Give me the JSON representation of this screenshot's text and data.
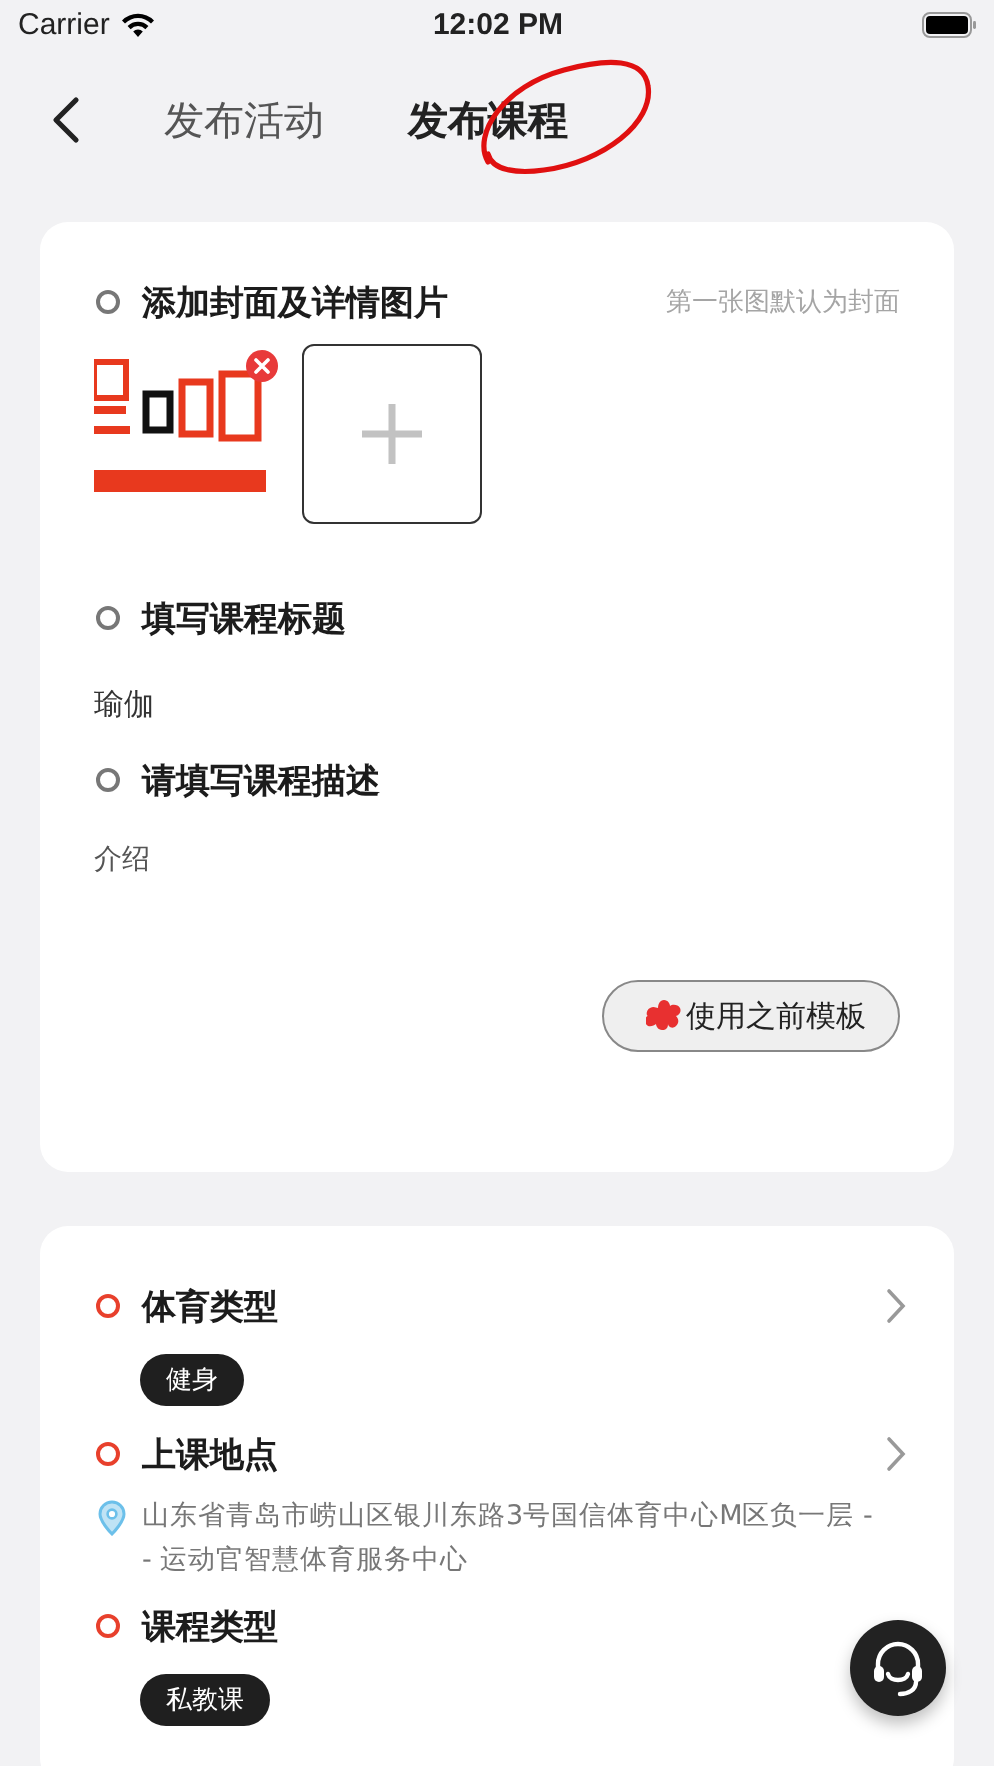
{
  "status_bar": {
    "carrier": "Carrier",
    "time": "12:02 PM"
  },
  "tabs": [
    {
      "label": "发布活动",
      "selected": false
    },
    {
      "label": "发布课程",
      "selected": true,
      "annotated": true
    }
  ],
  "media_card": {
    "sections": [
      {
        "kind": "images",
        "title": "添加封面及详情图片",
        "required": false,
        "hint": "第一张图默认为封面"
      },
      {
        "kind": "text",
        "title": "填写课程标题",
        "required": false,
        "value": "瑜伽"
      },
      {
        "kind": "note",
        "title": "请填写课程描述",
        "required": false,
        "value": "介绍"
      }
    ],
    "template_button": "使用之前模板"
  },
  "details_card": {
    "sections": [
      {
        "kind": "chip",
        "title": "体育类型",
        "required": true,
        "chevron": true,
        "value": "健身"
      },
      {
        "kind": "address",
        "title": "上课地点",
        "required": true,
        "chevron": true,
        "value": "山东省青岛市崂山区银川东路3号国信体育中心M区负一层 -- 运动官智慧体育服务中心"
      },
      {
        "kind": "chip",
        "title": "课程类型",
        "required": true,
        "chevron": false,
        "value": "私教课"
      }
    ]
  }
}
